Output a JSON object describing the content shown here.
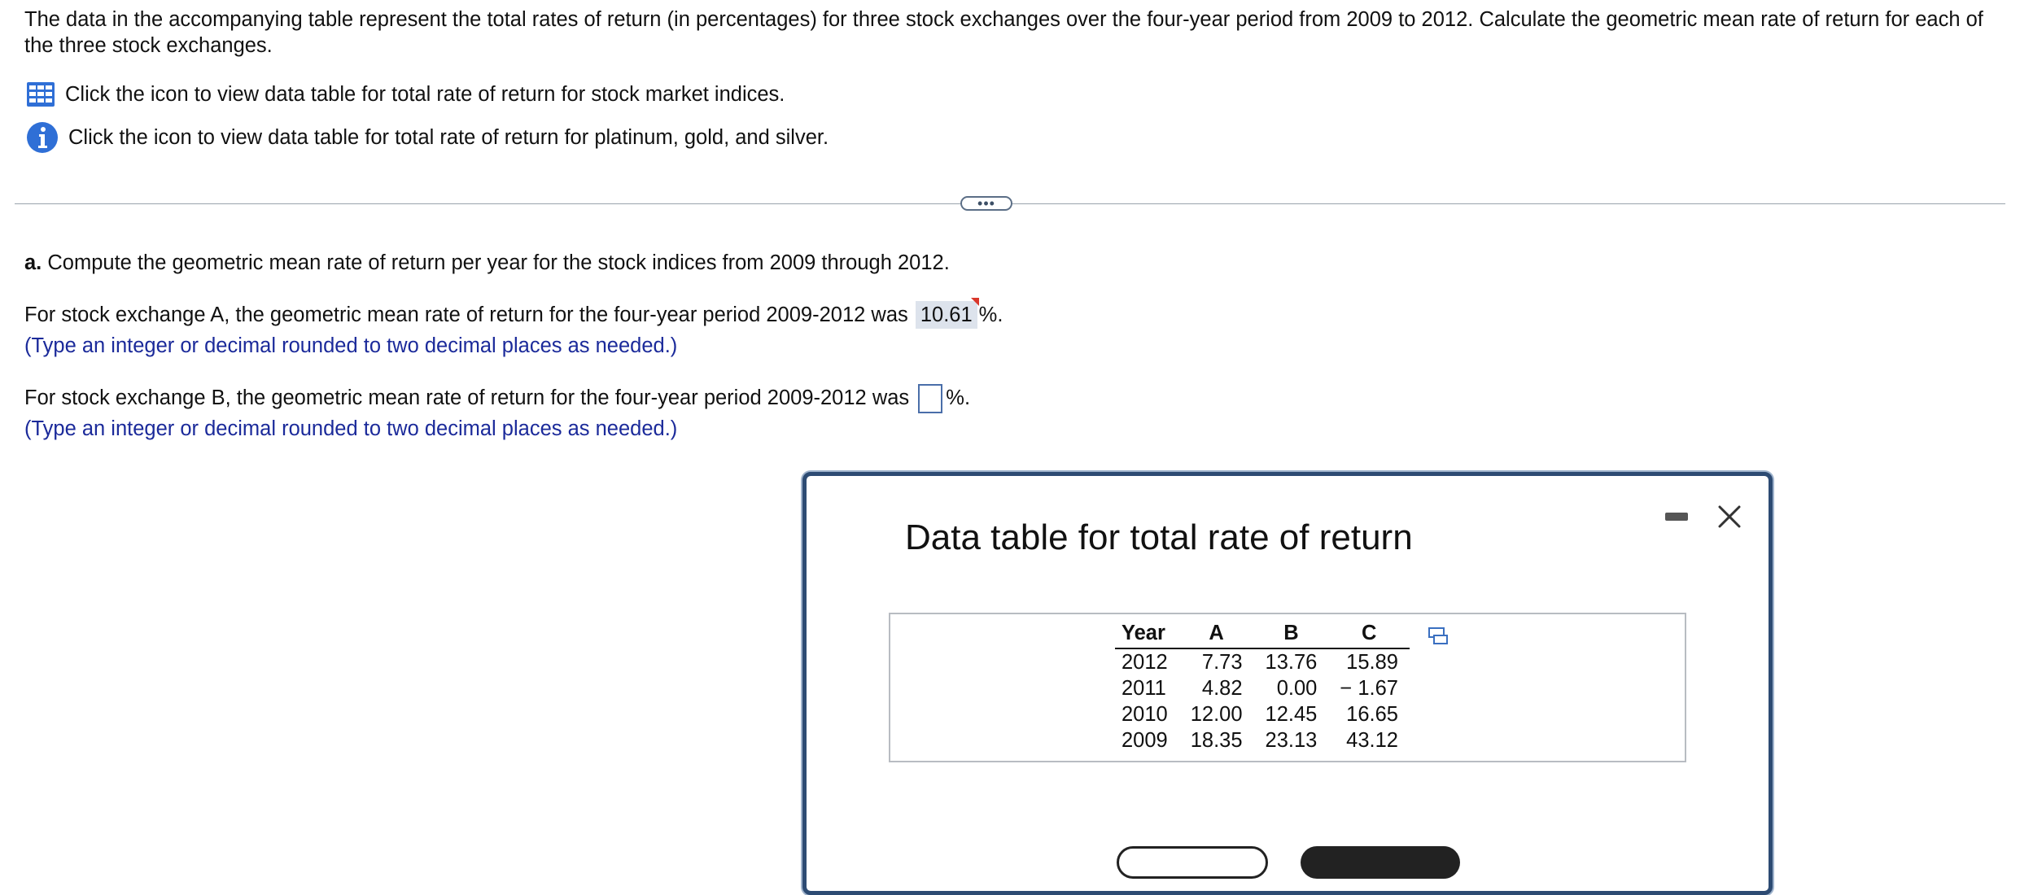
{
  "intro": "The data in the accompanying table represent the total rates of return (in percentages) for three stock exchanges over the four-year period from 2009 to 2012. Calculate the geometric mean rate of return for each of the three stock exchanges.",
  "links": [
    {
      "icon": "table-grid-icon",
      "text": "Click the icon to view data table for total rate of return for stock market indices."
    },
    {
      "icon": "info-icon",
      "text": "Click the icon to view data table for total rate of return for platinum, gold, and silver."
    }
  ],
  "more_button": "•••",
  "part_a": {
    "label": "a.",
    "question": "Compute the geometric mean rate of return per year for the stock indices from 2009 through 2012.",
    "q1_prefix": "For stock exchange A, the geometric mean rate of return for the four-year period 2009-2012 was",
    "q1_answer": "10.61",
    "q1_suffix": "%.",
    "q1_hint": "(Type an integer or decimal rounded to two decimal places as needed.)",
    "q2_prefix": "For stock exchange B, the geometric mean rate of return for the four-year period 2009-2012 was",
    "q2_answer": "",
    "q2_suffix": "%.",
    "q2_hint": "(Type an integer or decimal rounded to two decimal places as needed.)"
  },
  "modal": {
    "title": "Data table for total rate of return",
    "columns": [
      "Year",
      "A",
      "B",
      "C"
    ],
    "rows": [
      [
        "2012",
        "7.73",
        "13.76",
        "15.89"
      ],
      [
        "2011",
        "4.82",
        "0.00",
        "− 1.67"
      ],
      [
        "2010",
        "12.00",
        "12.45",
        "16.65"
      ],
      [
        "2009",
        "18.35",
        "23.13",
        "43.12"
      ]
    ]
  },
  "colors": {
    "hint": "#1b2a9a",
    "modal_border": "#2d4b73",
    "answer_bg": "#dde3ec",
    "link_icon": "#2f6fd6"
  }
}
